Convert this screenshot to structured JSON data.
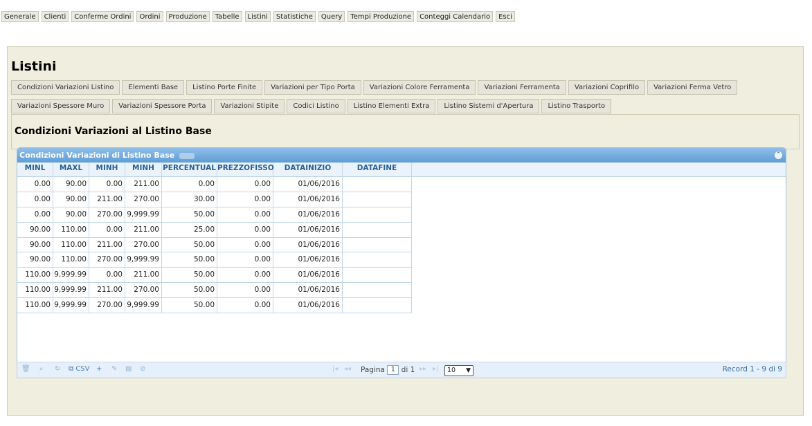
{
  "top_menu": [
    "Generale",
    "Clienti",
    "Conferme Ordini",
    "Ordini",
    "Produzione",
    "Tabelle",
    "Listini",
    "Statistiche",
    "Query",
    "Tempi Produzione",
    "Conteggi Calendario",
    "Esci"
  ],
  "page_title": "Listini",
  "tabs_row1": [
    "Condizioni Variazioni Listino",
    "Elementi Base",
    "Listino Porte Finite",
    "Variazioni per Tipo Porta",
    "Variazioni Colore Ferramenta",
    "Variazioni Ferramenta",
    "Variazioni Coprifilo",
    "Variazioni Ferma Vetro"
  ],
  "tabs_row2": [
    "Variazioni Spessore Muro",
    "Variazioni Spessore Porta",
    "Variazioni Stipite",
    "Codici Listino",
    "Listino Elementi Extra",
    "Listino Sistemi d'Apertura",
    "Listino Trasporto"
  ],
  "section_title": "Condizioni Variazioni al Listino Base",
  "grid": {
    "caption": "Condizioni Variazioni di Listino Base",
    "columns": [
      "MINL",
      "MAXL",
      "MINH",
      "MINH",
      "PERCENTUAL",
      "PREZZOFISSO",
      "DATAINIZIO",
      "DATAFINE"
    ],
    "rows": [
      [
        "0.00",
        "90.00",
        "0.00",
        "211.00",
        "0.00",
        "0.00",
        "01/06/2016",
        ""
      ],
      [
        "0.00",
        "90.00",
        "211.00",
        "270.00",
        "30.00",
        "0.00",
        "01/06/2016",
        ""
      ],
      [
        "0.00",
        "90.00",
        "270.00",
        "9,999.99",
        "50.00",
        "0.00",
        "01/06/2016",
        ""
      ],
      [
        "90.00",
        "110.00",
        "0.00",
        "211.00",
        "25.00",
        "0.00",
        "01/06/2016",
        ""
      ],
      [
        "90.00",
        "110.00",
        "211.00",
        "270.00",
        "50.00",
        "0.00",
        "01/06/2016",
        ""
      ],
      [
        "90.00",
        "110.00",
        "270.00",
        "9,999.99",
        "50.00",
        "0.00",
        "01/06/2016",
        ""
      ],
      [
        "110.00",
        "9,999.99",
        "0.00",
        "211.00",
        "50.00",
        "0.00",
        "01/06/2016",
        ""
      ],
      [
        "110.00",
        "9,999.99",
        "211.00",
        "270.00",
        "50.00",
        "0.00",
        "01/06/2016",
        ""
      ],
      [
        "110.00",
        "9,999.99",
        "270.00",
        "9,999.99",
        "50.00",
        "0.00",
        "01/06/2016",
        ""
      ]
    ]
  },
  "pager": {
    "csv_label": "CSV",
    "page_label": "Pagina",
    "page_value": "1",
    "of_label": "di 1",
    "rows_per_page": "10",
    "record_info": "Record 1 - 9 di 9"
  },
  "colors": {
    "caption_bg": "#6ea8dd",
    "panel_bg": "#f0eedf",
    "header_text": "#2a5f93"
  }
}
